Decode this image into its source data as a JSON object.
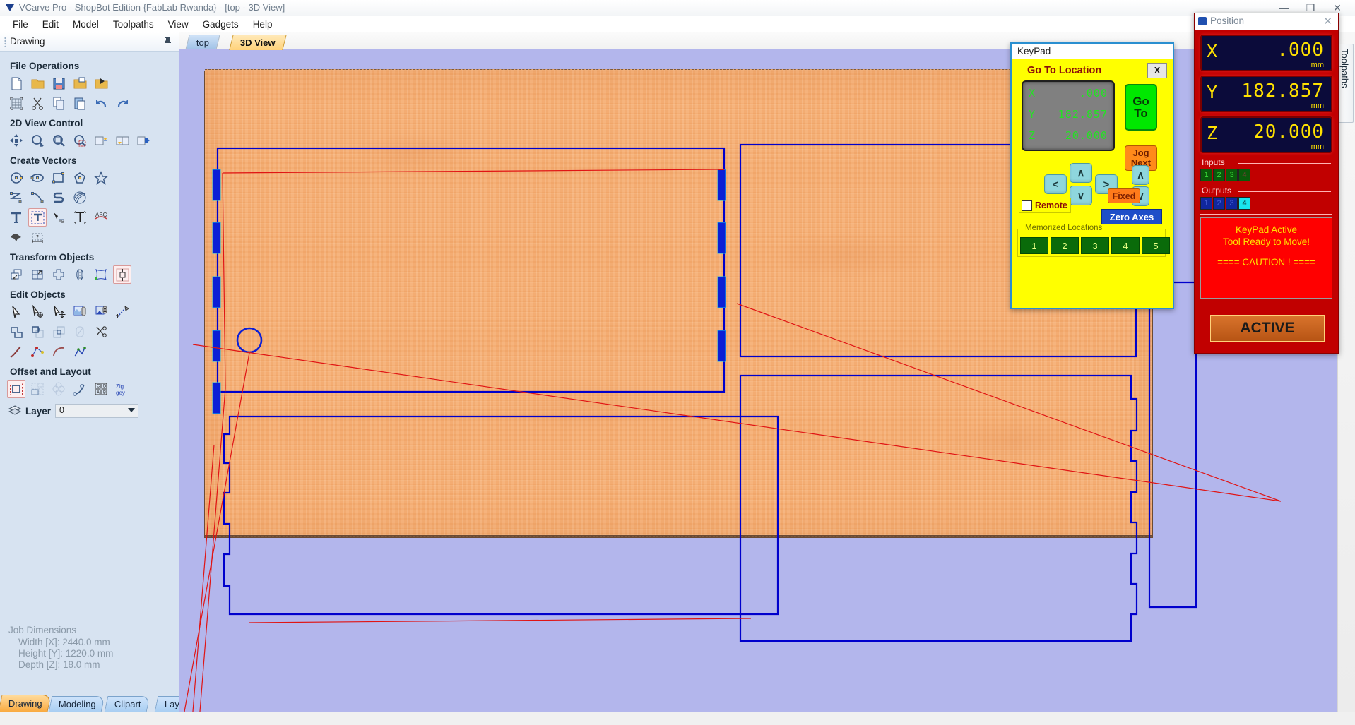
{
  "window": {
    "title": "VCarve Pro - ShopBot Edition {FabLab Rwanda} - [top - 3D View]",
    "minimize": "—",
    "maximize": "❐",
    "close": "✕"
  },
  "menu": {
    "items": [
      "File",
      "Edit",
      "Model",
      "Toolpaths",
      "View",
      "Gadgets",
      "Help"
    ]
  },
  "dock": {
    "title": "Drawing",
    "pin_icon": "pin-icon",
    "sections": [
      {
        "title": "File Operations",
        "rows": [
          [
            "new-file-icon",
            "open-folder-icon",
            "save-icon",
            "open-recent-icon",
            "import-vectors-icon"
          ],
          [
            "job-setup-icon",
            "cut-icon",
            "copy-icon",
            "paste-icon",
            "undo-icon",
            "redo-icon"
          ]
        ]
      },
      {
        "title": "2D View Control",
        "rows": [
          [
            "pan-icon",
            "zoom-in-icon",
            "zoom-extents-icon",
            "zoom-box-icon",
            "zoom-selected-icon",
            "toggle-2d3d-icon",
            "open-3d-icon"
          ]
        ]
      },
      {
        "title": "Create Vectors",
        "rows": [
          [
            "circle-icon",
            "ellipse-icon",
            "rectangle-icon",
            "polygon-icon",
            "star-icon"
          ],
          [
            "polyline-icon",
            "curve-icon",
            "spiral-icon",
            "texture-icon"
          ],
          [
            "create-text-icon",
            "edit-text-icon",
            "text-on-curve-icon",
            "auto-layout-text-icon",
            "text-arc-icon"
          ],
          [
            "trace-bitmap-icon",
            "dimension-icon"
          ]
        ]
      },
      {
        "title": "Transform Objects",
        "rows": [
          [
            "move-icon",
            "scale-icon",
            "rotate-icon",
            "mirror-icon",
            "distort-icon",
            "align-icon"
          ]
        ]
      },
      {
        "title": "Edit Objects",
        "rows": [
          [
            "select-icon",
            "node-edit-icon",
            "move-node-icon",
            "group-icon",
            "ungroup-icon",
            "measure-icon"
          ],
          [
            "weld-icon",
            "subtract-icon",
            "intersect-icon",
            "fillet-icon",
            "trim-icon"
          ],
          [
            "curve-fit-icon",
            "nodes-icon",
            "arc-icon",
            "polygon-node-icon"
          ]
        ]
      },
      {
        "title": "Offset and Layout",
        "rows": [
          [
            "offset-icon",
            "nest-icon",
            "array-copy-icon",
            "copy-along-curve-icon",
            "block-copy-icon",
            "zigzag-icon"
          ]
        ]
      }
    ],
    "layer": {
      "label": "Layer",
      "icon": "layers-icon",
      "value": "0",
      "dropdown_icon": "chevron-down-icon"
    },
    "job_dimensions": {
      "title": "Job Dimensions",
      "lines": [
        "Width  [X]: 2440.0 mm",
        "Height [Y]: 1220.0 mm",
        "Depth  [Z]: 18.0 mm"
      ]
    },
    "tabs": [
      {
        "label": "Drawing",
        "active": true
      },
      {
        "label": "Modeling",
        "active": false
      },
      {
        "label": "Clipart",
        "active": false
      },
      {
        "label": "Layers",
        "active": false
      }
    ]
  },
  "view": {
    "tabs": [
      {
        "label": "top",
        "active": false
      },
      {
        "label": "3D View",
        "active": true
      }
    ]
  },
  "right_strip": {
    "toolpaths_tab": "Toolpaths"
  },
  "keypad": {
    "window_title": "KeyPad",
    "heading": "Go To Location",
    "close_label": "X",
    "lcd": [
      {
        "axis": "X",
        "value": ".000"
      },
      {
        "axis": "Y",
        "value": "182.857"
      },
      {
        "axis": "Z",
        "value": "20.000"
      }
    ],
    "go_to": {
      "line1": "Go",
      "line2": "To"
    },
    "jog_next": {
      "line1": "Jog",
      "line2": "Next"
    },
    "arrows": {
      "left": "<",
      "right": ">",
      "up": "∧",
      "down": "∨",
      "z_up": "∧",
      "z_down": "∨"
    },
    "fixed_label": "Fixed",
    "remote_label": "Remote",
    "remote_checked": false,
    "zero_axes_label": "Zero Axes",
    "memorized": {
      "caption": "Memorized Locations",
      "buttons": [
        "1",
        "2",
        "3",
        "4",
        "5"
      ]
    }
  },
  "position": {
    "window_title": "Position",
    "close_icon": "close-icon",
    "dro": [
      {
        "axis": "X",
        "value": ".000",
        "unit": "mm"
      },
      {
        "axis": "Y",
        "value": "182.857",
        "unit": "mm"
      },
      {
        "axis": "Z",
        "value": "20.000",
        "unit": "mm"
      }
    ],
    "inputs": {
      "caption": "Inputs",
      "items": [
        {
          "label": "1",
          "on": true
        },
        {
          "label": "2",
          "on": true
        },
        {
          "label": "3",
          "on": true
        },
        {
          "label": "4",
          "on": false
        }
      ]
    },
    "outputs": {
      "caption": "Outputs",
      "items": [
        {
          "label": "1",
          "on": false
        },
        {
          "label": "2",
          "on": false
        },
        {
          "label": "3",
          "on": false
        },
        {
          "label": "4",
          "on": true
        }
      ]
    },
    "message": {
      "line1": "KeyPad Active",
      "line2": "Tool Ready to Move!",
      "line3": "==== CAUTION ! ===="
    },
    "active_label": "ACTIVE"
  },
  "colors": {
    "keypad_bg": "#ffff00",
    "position_bg": "#c10000",
    "dro_text": "#ffe100",
    "lcd_text": "#22e322",
    "go_button": "#00e800",
    "jog_button": "#ff8a1a",
    "zero_button": "#1e4ec8",
    "canvas_bg": "#b3b6ec",
    "material": "#f5ab6e",
    "vector_blue": "#0000cc",
    "toolpath_red": "#e01414"
  }
}
